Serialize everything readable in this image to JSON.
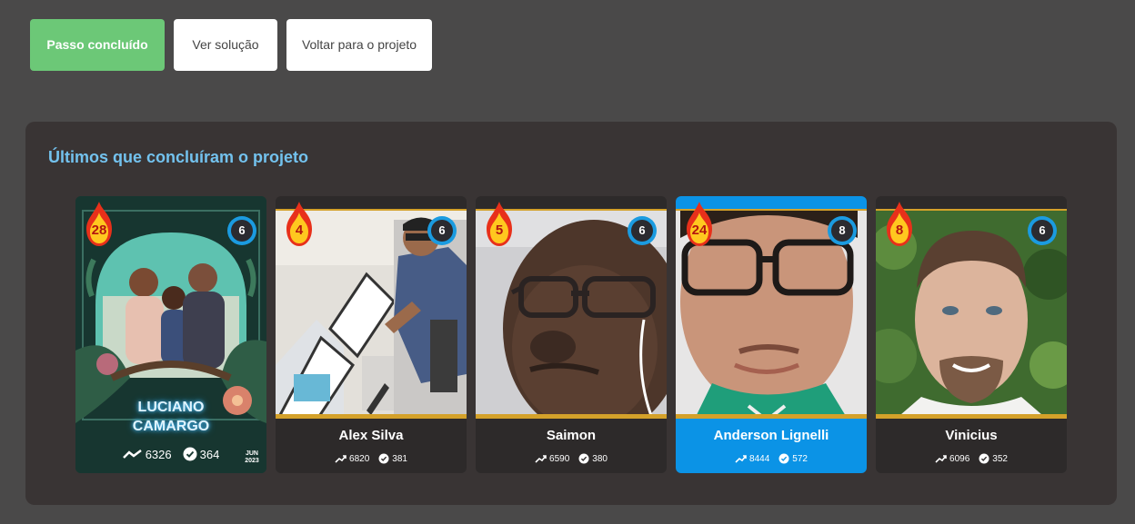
{
  "actions": {
    "done_label": "Passo concluído",
    "solution_label": "Ver solução",
    "back_label": "Voltar para o projeto"
  },
  "panel": {
    "title": "Últimos que concluíram o projeto"
  },
  "cards": [
    {
      "name": "LUCIANO CAMARGO",
      "streak": "28",
      "level": "6",
      "points": "6326",
      "completed": "364",
      "badge_date": "JUN 2023"
    },
    {
      "name": "Alex Silva",
      "streak": "4",
      "level": "6",
      "points": "6820",
      "completed": "381"
    },
    {
      "name": "Saimon",
      "streak": "5",
      "level": "6",
      "points": "6590",
      "completed": "380"
    },
    {
      "name": "Anderson Lignelli",
      "streak": "24",
      "level": "8",
      "points": "8444",
      "completed": "572"
    },
    {
      "name": "Vinicius",
      "streak": "8",
      "level": "6",
      "points": "6096",
      "completed": "352"
    }
  ],
  "colors": {
    "background": "#4a4949",
    "panel": "#393434",
    "accent_green": "#6cc877",
    "title_blue": "#73c2ee",
    "highlight_blue": "#0b93e6",
    "gold": "#d4a12a"
  },
  "icons": {
    "streak": "flame-icon",
    "level": "level-badge-icon",
    "points": "trend-up-icon",
    "completed": "check-circle-icon"
  }
}
